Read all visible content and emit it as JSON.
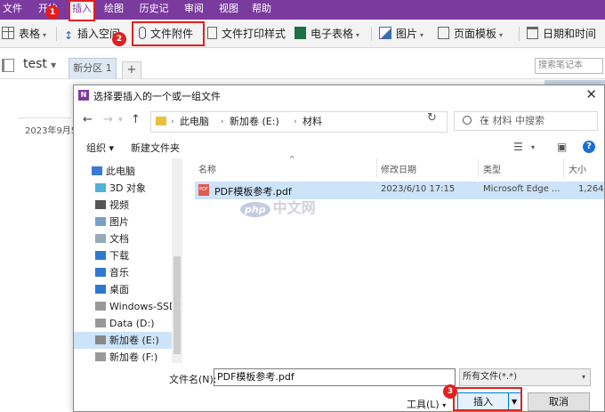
{
  "ribbon": {
    "menu": [
      "文件",
      "开始",
      "插入",
      "绘图",
      "历史记录",
      "审阅",
      "视图",
      "帮助"
    ],
    "active": "插入",
    "tools": {
      "table": "表格",
      "insert_space": "插入空间",
      "file_attachment": "文件附件",
      "file_printout": "文件打印样式",
      "spreadsheet": "电子表格",
      "picture": "图片",
      "page_template": "页面模板",
      "date_time": "日期和时间"
    }
  },
  "notebook": {
    "title": "test",
    "section_tab": "新分区 1",
    "add_tab": "+",
    "search_placeholder": "搜索笔记本",
    "page_date": "2023年9月5"
  },
  "dialog": {
    "title": "选择要插入的一个或一组文件",
    "close": "✕",
    "breadcrumb": [
      "此电脑",
      "新加卷 (E:)",
      "材料"
    ],
    "search_placeholder": "在 材料 中搜索",
    "organize": "组织 ▾",
    "new_folder": "新建文件夹",
    "nav_items": [
      "此电脑",
      "3D 对象",
      "视频",
      "图片",
      "文档",
      "下载",
      "音乐",
      "桌面",
      "Windows-SSD (",
      "Data (D:)",
      "新加卷 (E:)",
      "新加卷 (F:)"
    ],
    "selected_nav": "新加卷 (E:)",
    "columns": {
      "name": "名称",
      "modified": "修改日期",
      "type": "类型",
      "size": "大小"
    },
    "files": [
      {
        "name": "PDF模板参考.pdf",
        "modified": "2023/6/10 17:15",
        "type": "Microsoft Edge ...",
        "size": "1,264"
      }
    ],
    "filename_label": "文件名(N):",
    "filename_value": "PDF模板参考.pdf",
    "filetype": "所有文件(*.*)",
    "tools": "工具(L)",
    "insert": "插入",
    "cancel": "取消"
  },
  "annotations": {
    "b1": "1",
    "b2": "2",
    "b3": "3"
  },
  "watermark": {
    "logo": "php",
    "text": "中文网"
  },
  "colors": {
    "ribbon": "#7b3a9e",
    "annotation": "#e02020",
    "selection": "#cce3f8"
  }
}
